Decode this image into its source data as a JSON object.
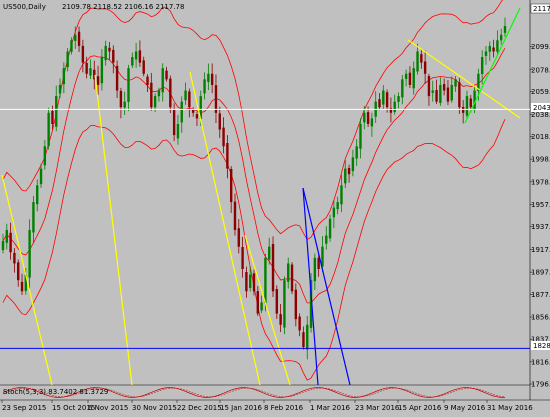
{
  "header": {
    "symbol_tf": "US500,Daily",
    "ohlc": "2109.78 2118.52 2106.16 2117.78"
  },
  "indicator": {
    "label": "Stoch(5,3,3) 83.7402 81.3729"
  },
  "price_axis": {
    "current_price": "2117.78",
    "white_line_price": "2043.11",
    "blue_line_price": "1828.89",
    "ticks": [
      "2099.30",
      "2078.60",
      "2059.10",
      "2038.40",
      "2018.90",
      "1998.50",
      "1978.10",
      "1957.90",
      "1937.90",
      "1917.50",
      "1897.20",
      "1877.30",
      "1856.90",
      "1837.10",
      "1816.70",
      "1796.90"
    ]
  },
  "time_axis": {
    "labels": [
      "23 Sep 2015",
      "15 Oct 2015",
      "6 Nov 2015",
      "30 Nov 2015",
      "22 Dec 2015",
      "15 Jan 2016",
      "8 Feb 2016",
      "1 Mar 2016",
      "23 Mar 2016",
      "15 Apr 2016",
      "9 May 2016",
      "31 May 2016"
    ]
  },
  "colors": {
    "background": "#c0c0c0",
    "bull_candle": "#008000",
    "bear_candle": "#8b0000",
    "bands": "#ff0000",
    "yellow_lines": "#ffff00",
    "green_line": "#00ff00",
    "blue_lines": "#0000ff",
    "price_box": "#ffffff"
  },
  "chart_data": {
    "type": "candlestick",
    "symbol": "US500",
    "timeframe": "Daily",
    "y_range": [
      1796.9,
      2130
    ],
    "last_close": 2117.78,
    "horizontal_levels": [
      {
        "price": 2043.11,
        "color": "#ffffff"
      },
      {
        "price": 1828.89,
        "color": "#0000ff"
      }
    ],
    "closes_approx": [
      1925,
      1935,
      1915,
      1905,
      1890,
      1880,
      1895,
      1935,
      1960,
      1975,
      1990,
      2010,
      2040,
      2030,
      2055,
      2065,
      2080,
      2095,
      2105,
      2110,
      2100,
      2085,
      2075,
      2080,
      2070,
      2065,
      2090,
      2100,
      2095,
      2085,
      2060,
      2045,
      2050,
      2080,
      2090,
      2095,
      2085,
      2075,
      2065,
      2045,
      2055,
      2060,
      2080,
      2070,
      2045,
      2020,
      2030,
      2050,
      2060,
      2045,
      2040,
      2035,
      2055,
      2070,
      2075,
      2065,
      2040,
      2025,
      2010,
      1990,
      1960,
      1935,
      1920,
      1900,
      1880,
      1895,
      1880,
      1860,
      1870,
      1910,
      1920,
      1880,
      1860,
      1850,
      1890,
      1905,
      1880,
      1855,
      1845,
      1830,
      1850,
      1890,
      1910,
      1900,
      1920,
      1930,
      1945,
      1955,
      1960,
      1975,
      1990,
      1985,
      2000,
      2010,
      2030,
      2040,
      2030,
      2035,
      2050,
      2045,
      2060,
      2045,
      2040,
      2050,
      2055,
      2070,
      2075,
      2065,
      2080,
      2095,
      2085,
      2075,
      2055,
      2060,
      2050,
      2065,
      2060,
      2050,
      2065,
      2070,
      2045,
      2040,
      2055,
      2045,
      2060,
      2075,
      2090,
      2095,
      2100,
      2095,
      2105,
      2110,
      2117.78
    ],
    "stoch_k": 83.7402,
    "stoch_d": 81.3729
  }
}
